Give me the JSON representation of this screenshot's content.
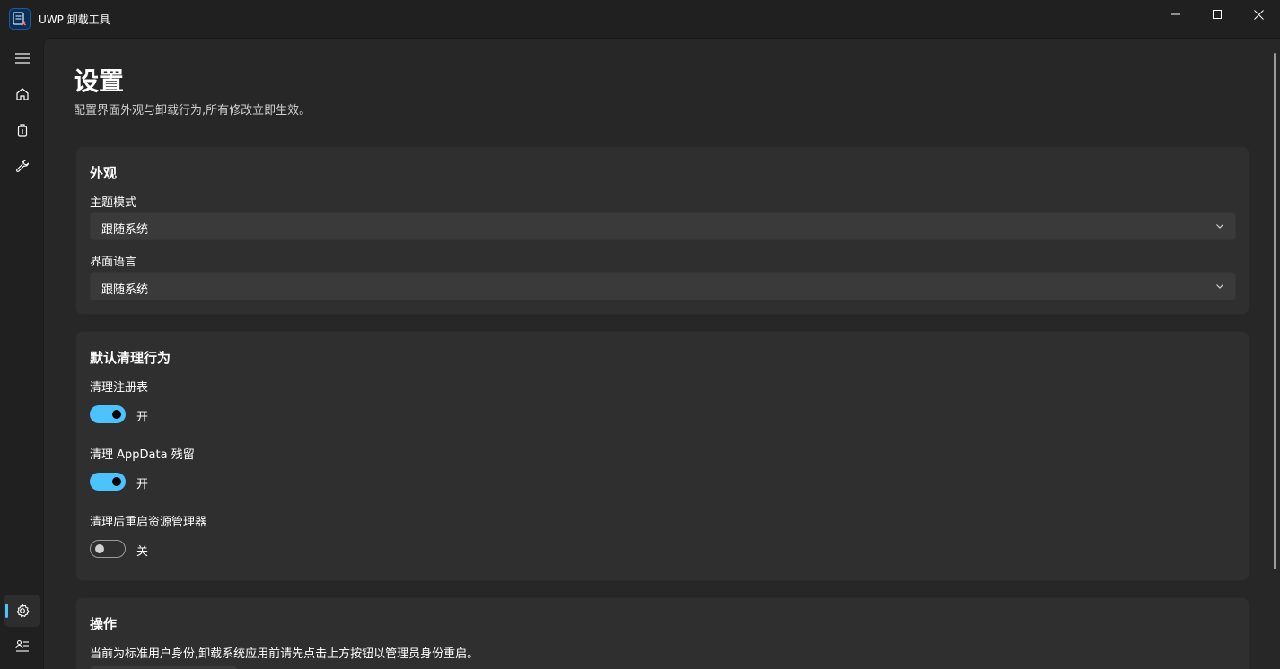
{
  "window": {
    "title": "UWP 卸载工具",
    "app_icon": "uninstall-app-icon",
    "controls": [
      "minimize-icon",
      "maximize-icon",
      "close-icon"
    ]
  },
  "nav": {
    "items": [
      {
        "icon": "hamburger-menu-icon",
        "label": ""
      },
      {
        "icon": "home-icon",
        "label": ""
      },
      {
        "icon": "package-icon",
        "label": ""
      },
      {
        "icon": "wrench-icon",
        "label": ""
      }
    ],
    "footer_items": [
      {
        "icon": "gear-icon",
        "selected": true
      },
      {
        "icon": "about-icon",
        "selected": false
      }
    ],
    "accent": "#4cc2ff"
  },
  "page": {
    "title": "设置",
    "subtitle": "配置界面外观与卸载行为,所有修改立即生效。"
  },
  "appearance": {
    "title": "外观",
    "theme_label": "主题模式",
    "theme_value": "跟随系统",
    "language_label": "界面语言",
    "language_value": "跟随系统"
  },
  "cleanup": {
    "title": "默认清理行为",
    "items": [
      {
        "label": "清理注册表",
        "state": "开",
        "on": true
      },
      {
        "label": "清理 AppData 残留",
        "state": "开",
        "on": true
      },
      {
        "label": "清理后重启资源管理器",
        "state": "关",
        "on": false
      }
    ]
  },
  "actions": {
    "title": "操作",
    "description": "当前为标准用户身份,卸载系统应用前请先点击上方按钮以管理员身份重启。"
  }
}
